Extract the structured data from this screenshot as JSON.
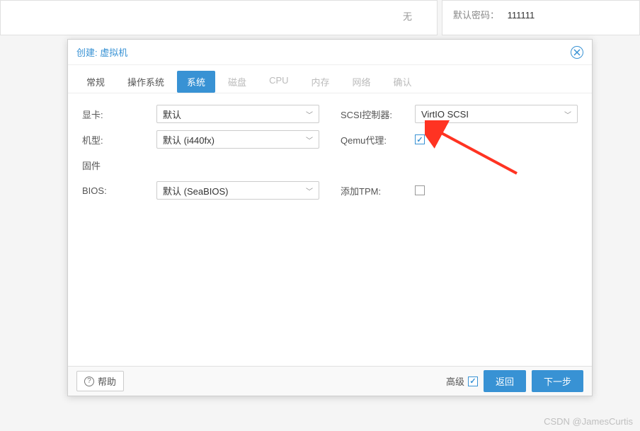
{
  "background": {
    "left_text": "无",
    "password_label": "默认密码：",
    "password_value": "111111"
  },
  "modal": {
    "title": "创建: 虚拟机",
    "tabs": {
      "general": "常规",
      "os": "操作系统",
      "system": "系统",
      "disk": "磁盘",
      "cpu": "CPU",
      "memory": "内存",
      "network": "网络",
      "confirm": "确认"
    },
    "left_col": {
      "gpu_label": "显卡:",
      "gpu_value": "默认",
      "machine_label": "机型:",
      "machine_value": "默认 (i440fx)",
      "firmware_label": "固件",
      "bios_label": "BIOS:",
      "bios_value": "默认 (SeaBIOS)"
    },
    "right_col": {
      "scsi_label": "SCSI控制器:",
      "scsi_value": "VirtIO SCSI",
      "qemu_label": "Qemu代理:",
      "tpm_label": "添加TPM:"
    },
    "footer": {
      "help": "帮助",
      "advanced": "高级",
      "back": "返回",
      "next": "下一步"
    }
  },
  "watermark": "CSDN @JamesCurtis"
}
